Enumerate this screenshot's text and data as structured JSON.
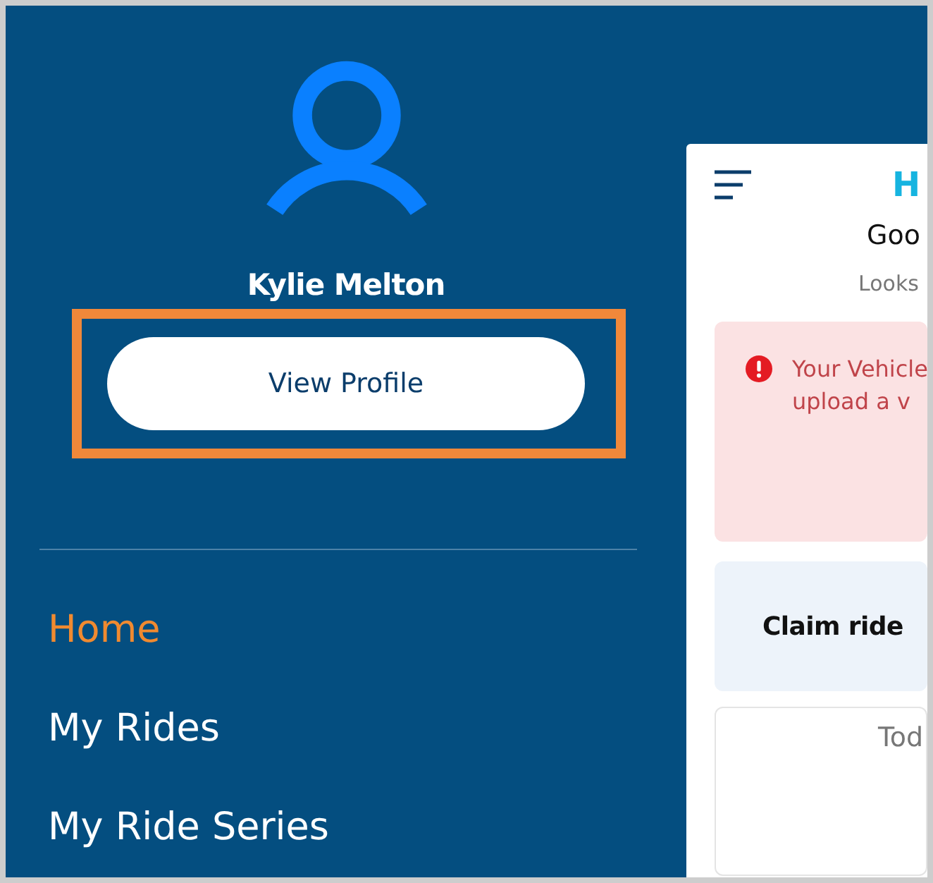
{
  "drawer": {
    "user_name": "Kylie Melton",
    "view_profile_button": {
      "label": "View Profile",
      "highlighted": true
    },
    "menu": [
      {
        "label": "Home",
        "selected": true
      },
      {
        "label": "My Rides",
        "selected": false
      },
      {
        "label": "My Ride Series",
        "selected": false
      }
    ]
  },
  "home_screen": {
    "title": "H",
    "greeting": "Goo",
    "subtitle": "Looks",
    "alert": {
      "lines": [
        "Your Vehicle",
        "upload a v"
      ]
    },
    "claim_card": {
      "text": "Claim ride"
    },
    "today_card": {
      "text": "Tod"
    }
  }
}
